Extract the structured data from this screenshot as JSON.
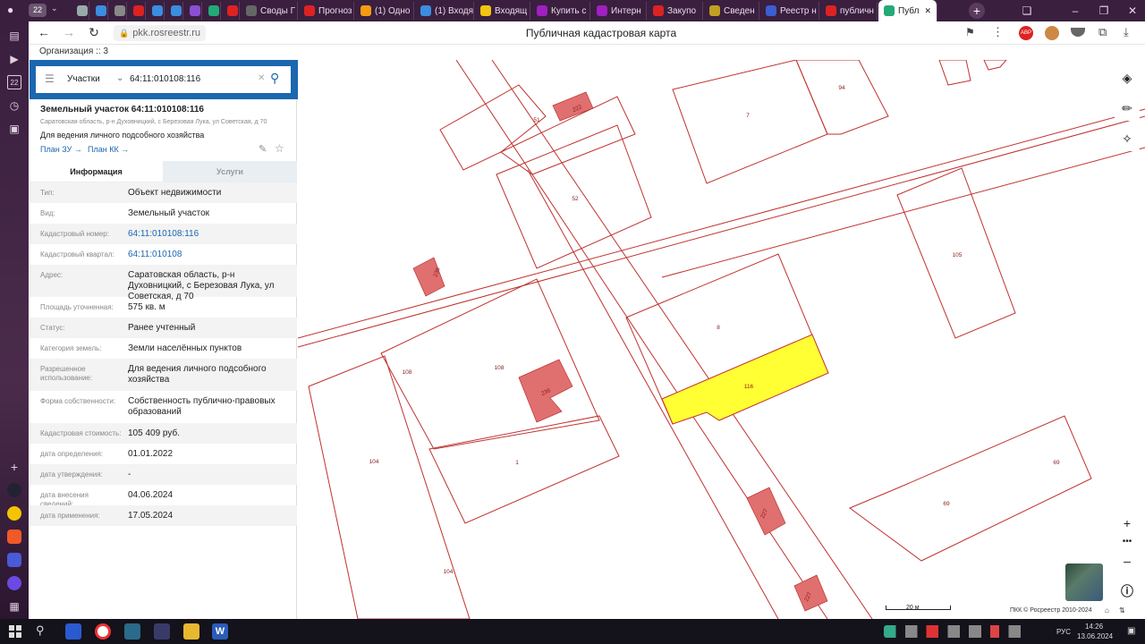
{
  "browser": {
    "tab_counter": "22",
    "tabs": [
      {
        "label": "",
        "color": "#9aa",
        "width": 20
      },
      {
        "label": "",
        "color": "#3b8de0",
        "width": 20
      },
      {
        "label": "",
        "color": "#888",
        "width": 20
      },
      {
        "label": "",
        "color": "#d22",
        "width": 20
      },
      {
        "label": "",
        "color": "#3b8de0",
        "width": 20
      },
      {
        "label": "",
        "color": "#3b8de0",
        "width": 20
      },
      {
        "label": "",
        "color": "#8a4fd0",
        "width": 20
      },
      {
        "label": "",
        "color": "#2a7",
        "width": 20
      },
      {
        "label": "",
        "color": "#d22",
        "width": 20
      },
      {
        "label": "Своды Г",
        "color": "#666",
        "width": 64
      },
      {
        "label": "Прогноз",
        "color": "#d22",
        "width": 62
      },
      {
        "label": "(1) Одно",
        "color": "#f39c12",
        "width": 66
      },
      {
        "label": "(1) Входя",
        "color": "#3b8de0",
        "width": 66
      },
      {
        "label": "Входящ",
        "color": "#f1c40f",
        "width": 62
      },
      {
        "label": "Купить с",
        "color": "#a020c0",
        "width": 66
      },
      {
        "label": "Интерн",
        "color": "#a020c0",
        "width": 62
      },
      {
        "label": "Закупо",
        "color": "#d22",
        "width": 62
      },
      {
        "label": "Сведен",
        "color": "#c0a020",
        "width": 62
      },
      {
        "label": "Реестр н",
        "color": "#3b5ed0",
        "width": 66
      },
      {
        "label": "публичн",
        "color": "#d22",
        "width": 64
      },
      {
        "label": "Публ",
        "color": "#2a7",
        "width": 66
      }
    ],
    "url": "pkk.rosreestr.ru",
    "page_title": "Публичная кадастровая карта",
    "bookmark": "Организация :: 3"
  },
  "search": {
    "layer": "Участки",
    "query": "64:11:010108:116"
  },
  "parcel": {
    "title": "Земельный участок 64:11:010108:116",
    "address_short": "Саратовская область, р-н Духовницкий, с Березовая Лука, ул Советская, д 70",
    "usage": "Для ведения личного подсобного хозяйства",
    "plan_zu": "План ЗУ →",
    "plan_kk": "План КК →",
    "tab_info": "Информация",
    "tab_services": "Услуги"
  },
  "info_rows": [
    {
      "key": "Тип:",
      "val": "Объект недвижимости",
      "link": false
    },
    {
      "key": "Вид:",
      "val": "Земельный участок",
      "link": false
    },
    {
      "key": "Кадастровый номер:",
      "val": "64:11:010108:116",
      "link": true
    },
    {
      "key": "Кадастровый квартал:",
      "val": "64:11:010108",
      "link": true
    },
    {
      "key": "Адрес:",
      "val": "Саратовская область, р-н Духовницкий, с Березовая Лука, ул Советская, д 70",
      "link": false
    },
    {
      "key": "Площадь уточненная:",
      "val": "575 кв. м",
      "link": false
    },
    {
      "key": "Статус:",
      "val": "Ранее учтенный",
      "link": false
    },
    {
      "key": "Категория земель:",
      "val": "Земли населённых пунктов",
      "link": false
    },
    {
      "key": "Разрешенное использование:",
      "val": "Для ведения личного подсобного хозяйства",
      "link": false
    },
    {
      "key": "Форма собственности:",
      "val": "Собственность публично-правовых образований",
      "link": false
    },
    {
      "key": "Кадастровая стоимость:",
      "val": "105 409 руб.",
      "link": false
    },
    {
      "key": "дата определения:",
      "val": "01.01.2022",
      "link": false
    },
    {
      "key": "дата утверждения:",
      "val": "-",
      "link": false
    },
    {
      "key": "дата внесения сведений:",
      "val": "04.06.2024",
      "link": false
    },
    {
      "key": "дата применения:",
      "val": "17.05.2024",
      "link": false
    }
  ],
  "map": {
    "labels": [
      "51",
      "222",
      "7",
      "94",
      "52",
      "105",
      "8",
      "116",
      "108",
      "108",
      "236",
      "104",
      "1",
      "69",
      "69",
      "104"
    ],
    "rotated_labels": [
      "222",
      "236",
      "236",
      "227",
      "227"
    ],
    "scale": "20 м",
    "copyright": "ПКК © Росреестр 2010-2024",
    "highlight_color": "#ffff33",
    "boundary_color": "#c0322f",
    "building_color": "#e07070"
  },
  "taskbar": {
    "lang": "РУС",
    "time": "14:26",
    "date": "13.06.2024"
  }
}
